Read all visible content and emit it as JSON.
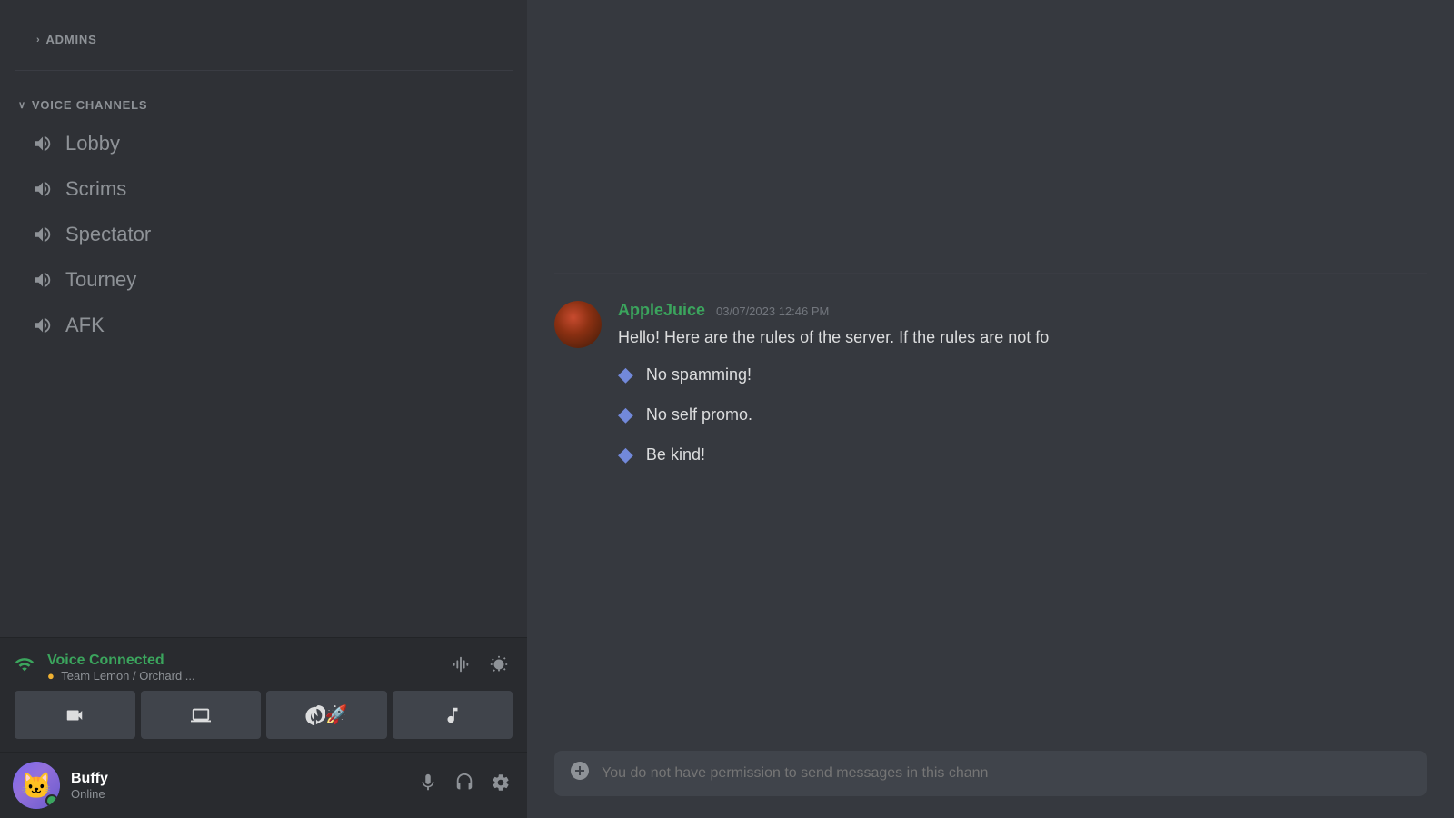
{
  "sidebar": {
    "admins_label": "ADMINS",
    "voice_channels_label": "VOICE CHANNELS",
    "voice_channels": [
      {
        "name": "Lobby",
        "icon": "🔊"
      },
      {
        "name": "Scrims",
        "icon": "🔊"
      },
      {
        "name": "Spectator",
        "icon": "🔊"
      },
      {
        "name": "Tourney",
        "icon": "🔊"
      },
      {
        "name": "AFK",
        "icon": "🔊"
      }
    ],
    "voice_connected": {
      "label": "Voice Connected",
      "channel": "Team Lemon / Orchard ..."
    },
    "user": {
      "name": "Buffy",
      "status": "Online",
      "avatar_emoji": "🐱"
    }
  },
  "chat": {
    "message": {
      "author": "AppleJuice",
      "timestamp": "03/07/2023 12:46 PM",
      "text": "Hello! Here are the rules of the server. If the rules are not fo",
      "rules": [
        "No spamming!",
        "No self promo.",
        "Be kind!"
      ]
    },
    "input_placeholder": "You do not have permission to send messages in this chann"
  },
  "icons": {
    "chevron_right": "›",
    "chevron_down": "∨",
    "volume": "🔊",
    "mic": "🎤",
    "headset": "🎧",
    "settings": "⚙",
    "camera": "📷",
    "screen_share": "🖥",
    "activity": "🚀",
    "music": "🎵",
    "signal": "📶",
    "disconnect": "✖",
    "sound_wave": "🔊",
    "add": "➕",
    "diamond": "◆"
  }
}
